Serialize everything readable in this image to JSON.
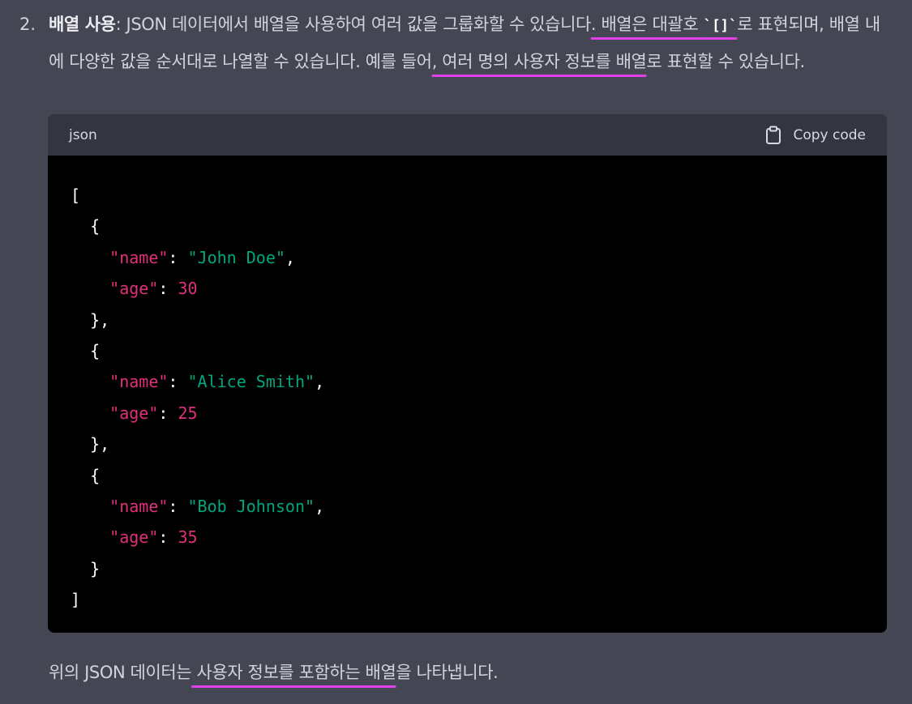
{
  "list_number": "2.",
  "intro": {
    "title": "배열 사용",
    "after_title": ": JSON 데이터에서 배열을 사용하여 여러 값을 그룹화할 수 있습니다",
    "hl1": ". 배열은 대괄호 ",
    "inline_code": "`[]`",
    "after_code": "로 표현되며, 배열 내에 다양한 값을 순서대로 나열할 수 있습니다. 예를 들어",
    "hl2": ", 여러 명의 사용자 정보를 배열",
    "tail": "로 표현할 수 있습니다."
  },
  "code_block": {
    "language": "json",
    "copy_label": "Copy code",
    "lines": [
      [
        {
          "t": "punc",
          "v": "["
        }
      ],
      [
        {
          "t": "punc",
          "v": "  {"
        }
      ],
      [
        {
          "t": "punc",
          "v": "    "
        },
        {
          "t": "key",
          "v": "\"name\""
        },
        {
          "t": "punc",
          "v": ": "
        },
        {
          "t": "str",
          "v": "\"John Doe\""
        },
        {
          "t": "punc",
          "v": ","
        }
      ],
      [
        {
          "t": "punc",
          "v": "    "
        },
        {
          "t": "key",
          "v": "\"age\""
        },
        {
          "t": "punc",
          "v": ": "
        },
        {
          "t": "num",
          "v": "30"
        }
      ],
      [
        {
          "t": "punc",
          "v": "  },"
        }
      ],
      [
        {
          "t": "punc",
          "v": "  {"
        }
      ],
      [
        {
          "t": "punc",
          "v": "    "
        },
        {
          "t": "key",
          "v": "\"name\""
        },
        {
          "t": "punc",
          "v": ": "
        },
        {
          "t": "str",
          "v": "\"Alice Smith\""
        },
        {
          "t": "punc",
          "v": ","
        }
      ],
      [
        {
          "t": "punc",
          "v": "    "
        },
        {
          "t": "key",
          "v": "\"age\""
        },
        {
          "t": "punc",
          "v": ": "
        },
        {
          "t": "num",
          "v": "25"
        }
      ],
      [
        {
          "t": "punc",
          "v": "  },"
        }
      ],
      [
        {
          "t": "punc",
          "v": "  {"
        }
      ],
      [
        {
          "t": "punc",
          "v": "    "
        },
        {
          "t": "key",
          "v": "\"name\""
        },
        {
          "t": "punc",
          "v": ": "
        },
        {
          "t": "str",
          "v": "\"Bob Johnson\""
        },
        {
          "t": "punc",
          "v": ","
        }
      ],
      [
        {
          "t": "punc",
          "v": "    "
        },
        {
          "t": "key",
          "v": "\"age\""
        },
        {
          "t": "punc",
          "v": ": "
        },
        {
          "t": "num",
          "v": "35"
        }
      ],
      [
        {
          "t": "punc",
          "v": "  }"
        }
      ],
      [
        {
          "t": "punc",
          "v": "]"
        }
      ]
    ]
  },
  "outro": {
    "before": "위의 JSON 데이터는",
    "hl": " 사용자 정보를 포함하는 배열",
    "after": "을 나타냅니다."
  },
  "colors": {
    "background": "#444654",
    "highlight_underline": "#e040e8",
    "code_key": "#df3079",
    "code_string": "#00a67d"
  }
}
